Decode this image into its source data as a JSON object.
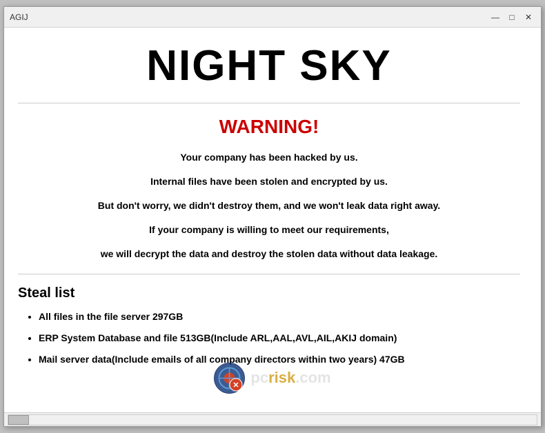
{
  "window": {
    "title": "AGIJ",
    "controls": {
      "minimize": "—",
      "maximize": "□",
      "close": "✕"
    }
  },
  "content": {
    "main_title": "NIGHT SKY",
    "warning_title": "WARNING!",
    "messages": [
      "Your company has been hacked by us.",
      "Internal files have been stolen and encrypted by us.",
      "But don't worry, we didn't destroy them, and we won't leak data right away.",
      "If your company is willing to meet our requirements,",
      "we will decrypt the data and destroy the stolen data without data leakage."
    ],
    "steal_list_title": "Steal list",
    "steal_items": [
      "All files in the file server  297GB",
      "ERP System Database and file  513GB(Include ARL,AAL,AVL,AIL,AKIJ domain)",
      "Mail server data(Include emails of all company directors within two years)  47GB"
    ]
  },
  "watermark": {
    "text": "pcrisk.com"
  }
}
